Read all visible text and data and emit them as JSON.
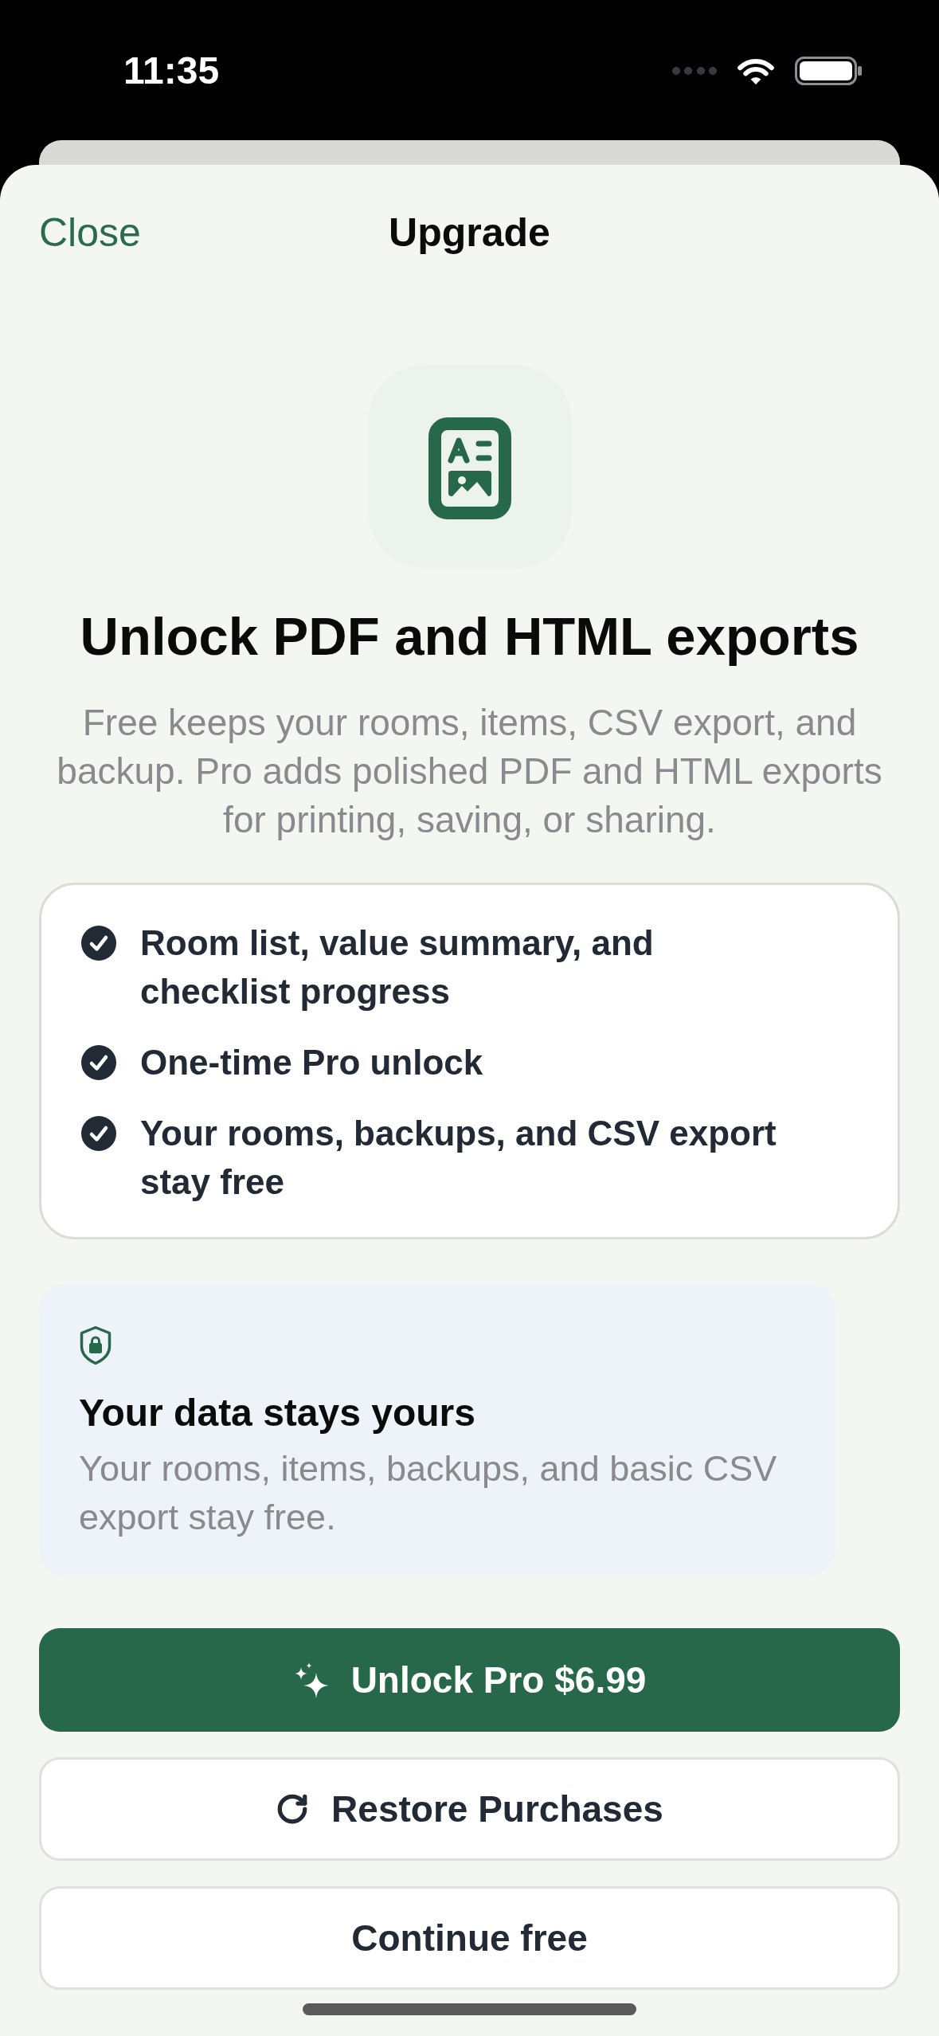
{
  "status_bar": {
    "time": "11:35"
  },
  "nav": {
    "close": "Close",
    "title": "Upgrade"
  },
  "hero": {
    "title": "Unlock PDF and HTML exports",
    "subtitle": "Free keeps your rooms, items, CSV export, and backup. Pro adds polished PDF and HTML exports for printing, saving, or sharing."
  },
  "features": [
    "Room list, value summary, and checklist progress",
    "One-time Pro unlock",
    "Your rooms, backups, and CSV export stay free"
  ],
  "notice": {
    "title": "Your data stays yours",
    "text": "Your rooms, items, backups, and basic CSV export stay free."
  },
  "actions": {
    "unlock": "Unlock Pro $6.99",
    "restore": "Restore Purchases",
    "continue": "Continue free"
  }
}
